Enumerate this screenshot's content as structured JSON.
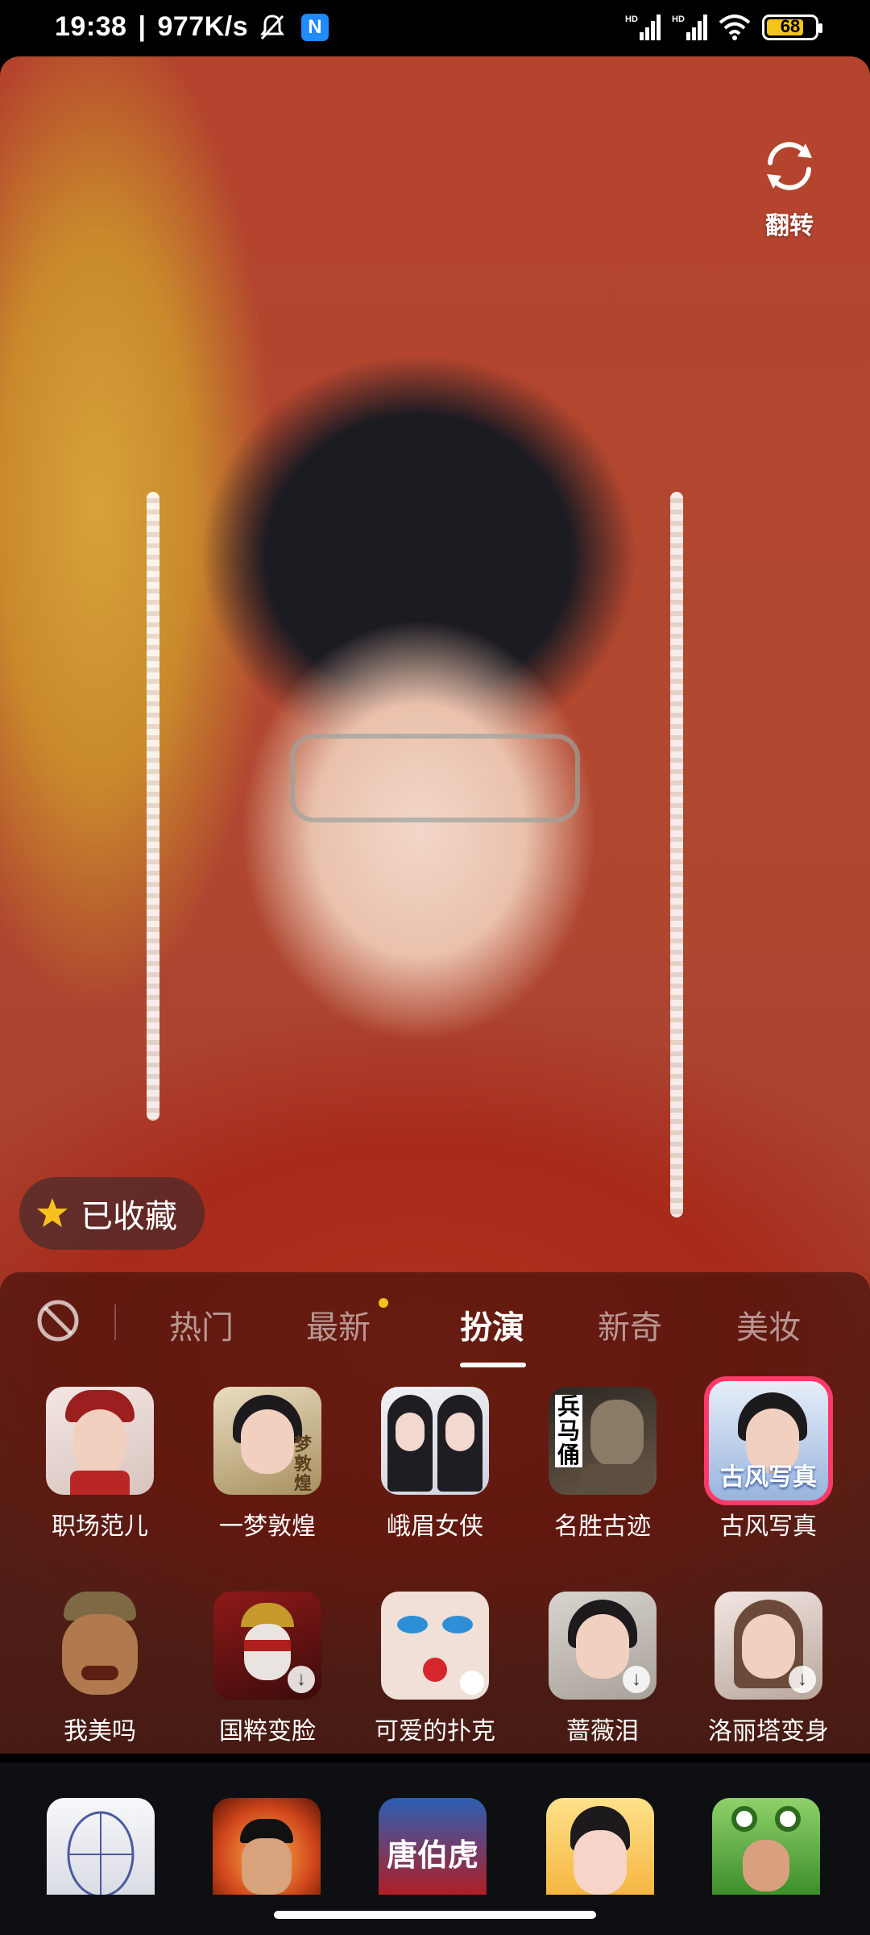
{
  "status_bar": {
    "time": "19:38",
    "speed": "977K/s",
    "app_badge": "N",
    "signal1_label": "HD",
    "signal2_label": "HD",
    "battery": "68",
    "icons": [
      "bell-muted-icon",
      "n-app-icon",
      "signal-icon",
      "signal-icon",
      "wifi-icon",
      "battery-icon"
    ]
  },
  "camera": {
    "flip_label": "翻转",
    "favorite_label": "已收藏",
    "accent_color": "#f6c21b"
  },
  "tabs": {
    "items": [
      "热门",
      "最新",
      "扮演",
      "新奇",
      "美妆"
    ],
    "active": "扮演"
  },
  "effects": {
    "row1": [
      {
        "label": "职场范儿"
      },
      {
        "label": "一梦敦煌",
        "art_text": "梦敦煌"
      },
      {
        "label": "峨眉女侠"
      },
      {
        "label": "名胜古迹",
        "art_text": "兵马俑"
      },
      {
        "label": "古风写真",
        "art_text": "古风写真",
        "selected": true
      }
    ],
    "row2": [
      {
        "label": "我美吗"
      },
      {
        "label": "国粹变脸"
      },
      {
        "label": "可爱的扑克"
      },
      {
        "label": "蔷薇泪"
      },
      {
        "label": "洛丽塔变身"
      }
    ]
  },
  "bottom_tray": {
    "items": [
      {
        "name": "sketch-face"
      },
      {
        "name": "opera-mask"
      },
      {
        "name": "tang-bohu",
        "text": "唐伯虎"
      },
      {
        "name": "cartoon-girl"
      },
      {
        "name": "frog-hood"
      }
    ]
  },
  "colors": {
    "selected_border": "#ff3a6a",
    "battery_fill": "#f5c518"
  }
}
